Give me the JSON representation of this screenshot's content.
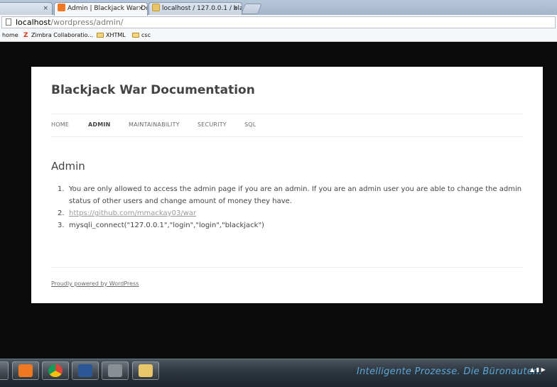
{
  "browser": {
    "tabs": [
      {
        "title": "",
        "favicon": "blank-page-icon"
      },
      {
        "title": "Admin | Blackjack War Do",
        "favicon": "xampp-icon"
      },
      {
        "title": "localhost / 127.0.0.1 / blac",
        "favicon": "phpmyadmin-icon"
      }
    ],
    "close_glyph": "×",
    "address": {
      "host": "localhost",
      "path": "/wordpress/admin/"
    },
    "bookmarks": [
      {
        "label": "home",
        "icon": "none"
      },
      {
        "label": "Zimbra Collaboratio...",
        "icon": "zimbra-icon"
      },
      {
        "label": "XHTML",
        "icon": "folder-icon"
      },
      {
        "label": "csc",
        "icon": "folder-icon"
      }
    ]
  },
  "site": {
    "title": "Blackjack War Documentation",
    "nav": [
      "HOME",
      "ADMIN",
      "MAINTAINABILITY",
      "SECURITY",
      "SQL"
    ],
    "current_nav": "ADMIN",
    "page_heading": "Admin",
    "items": [
      {
        "num": "1.",
        "text": "You are only allowed to access the admin page if you are an admin. If you are an admin user you are able to change the admin status of other users and change amount of money they have."
      },
      {
        "num": "2.",
        "text": "https://github.com/mmackay03/war",
        "link": true
      },
      {
        "num": "3.",
        "text": "mysqli_connect(\"127.0.0.1\",\"login\",\"login\",\"blackjack\")"
      }
    ],
    "footer": "Proudly powered by WordPress"
  },
  "taskbar": {
    "apps": [
      "xampp-icon",
      "chrome-icon",
      "word-icon",
      "unknown-app-icon",
      "file-explorer-icon"
    ],
    "brand_text": "Intelligente Prozesse. Die Büronauten.",
    "tray_glyph": "▲ ▮ ▶"
  },
  "colors": {
    "accent_link": "#9a9a9a",
    "title": "#444444",
    "page_bg": "#0b0b0b"
  }
}
